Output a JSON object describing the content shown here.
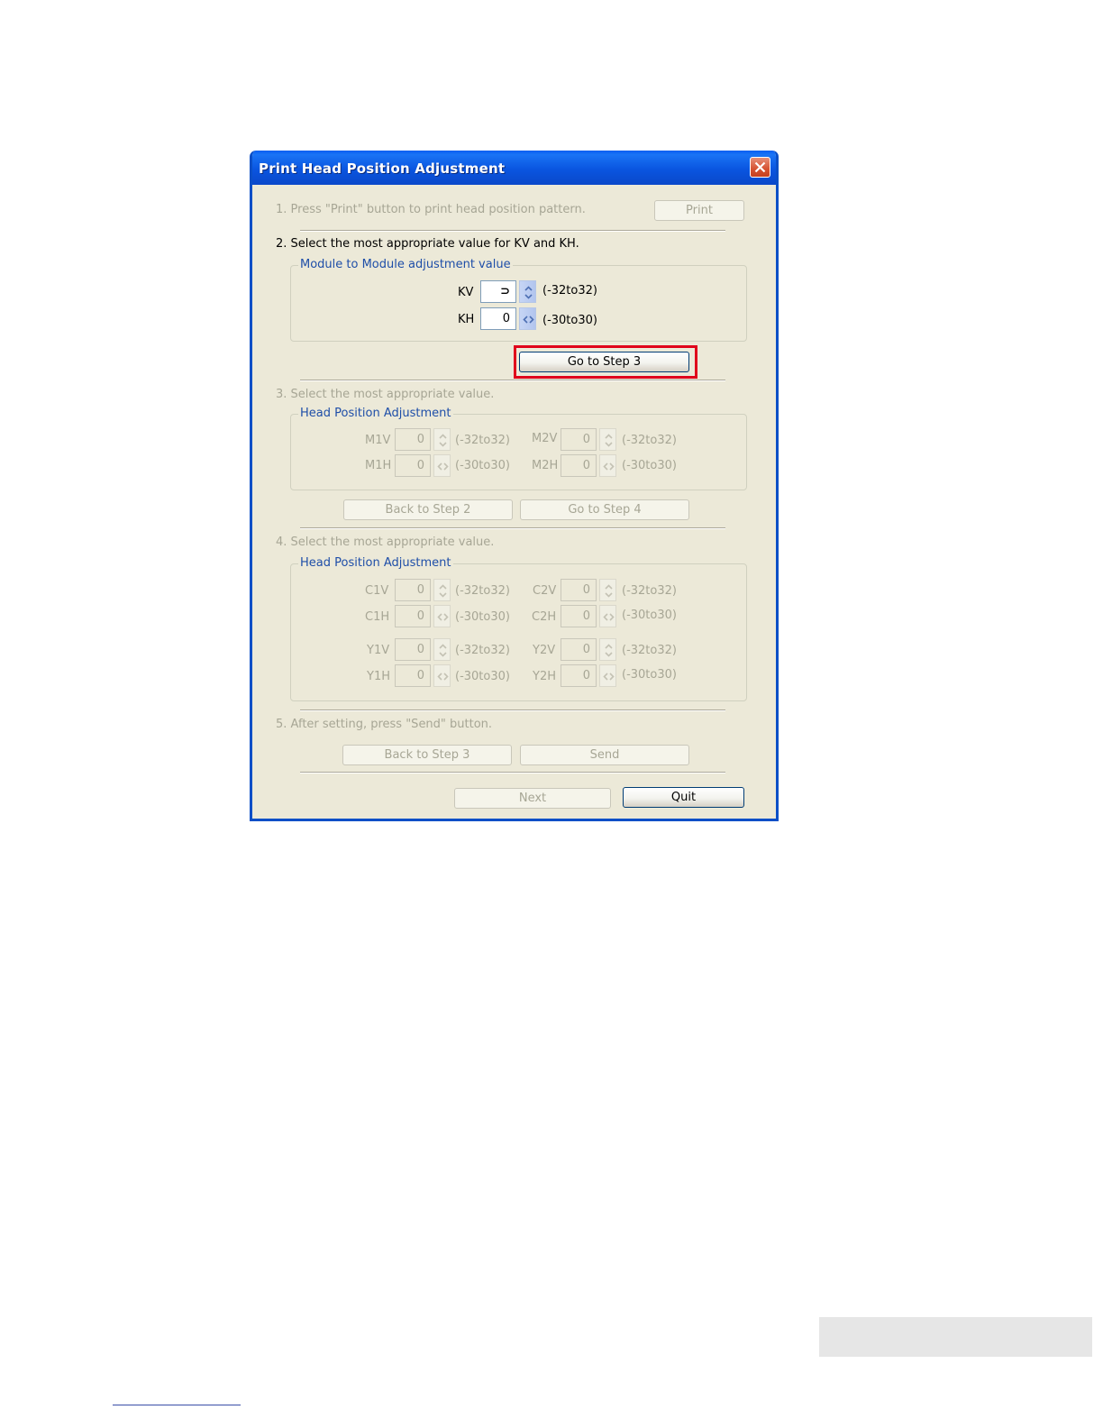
{
  "dialog": {
    "title": "Print Head Position Adjustment",
    "step1": {
      "text": "1. Press \"Print\" button to print head position pattern.",
      "print_label": "Print"
    },
    "step2": {
      "text": "2. Select the most appropriate value for KV and KH.",
      "group_label": "Module to Module adjustment value",
      "kv": {
        "label": "KV",
        "value": "⊃",
        "range": "(-32to32)"
      },
      "kh": {
        "label": "KH",
        "value": "0",
        "range": "(-30to30)"
      },
      "go_step3_label": "Go to Step 3"
    },
    "step3": {
      "text": "3. Select the most appropriate value.",
      "group_label": "Head Position Adjustment",
      "m1v": {
        "label": "M1V",
        "value": "0",
        "range": "(-32to32)"
      },
      "m2v": {
        "label": "M2V",
        "value": "0",
        "range": "(-32to32)"
      },
      "m1h": {
        "label": "M1H",
        "value": "0",
        "range": "(-30to30)"
      },
      "m2h": {
        "label": "M2H",
        "value": "0",
        "range": "(-30to30)"
      },
      "back_label": "Back to Step 2",
      "go_step4_label": "Go to Step 4"
    },
    "step4": {
      "text": "4. Select the most appropriate value.",
      "group_label": "Head Position Adjustment",
      "c1v": {
        "label": "C1V",
        "value": "0",
        "range": "(-32to32)"
      },
      "c2v": {
        "label": "C2V",
        "value": "0",
        "range": "(-32to32)"
      },
      "c1h": {
        "label": "C1H",
        "value": "0",
        "range": "(-30to30)"
      },
      "c2h": {
        "label": "C2H",
        "value": "0",
        "range": "(-30to30)"
      },
      "y1v": {
        "label": "Y1V",
        "value": "0",
        "range": "(-32to32)"
      },
      "y2v": {
        "label": "Y2V",
        "value": "0",
        "range": "(-32to32)"
      },
      "y1h": {
        "label": "Y1H",
        "value": "0",
        "range": "(-30to30)"
      },
      "y2h": {
        "label": "Y2H",
        "value": "0",
        "range": "(-30to30)"
      }
    },
    "step5": {
      "text": "5. After setting, press \"Send\" button.",
      "back_label": "Back to Step 3",
      "send_label": "Send"
    },
    "next_label": "Next",
    "quit_label": "Quit"
  },
  "colors": {
    "title_bar": "#0a55e0",
    "dialog_bg": "#ece9d8",
    "group_label": "#1e4ea8",
    "disabled_text": "#a7a695",
    "highlight_box": "#e0001b"
  },
  "icons": [
    "close-icon",
    "spin-up-down-icon",
    "spin-left-right-icon"
  ]
}
